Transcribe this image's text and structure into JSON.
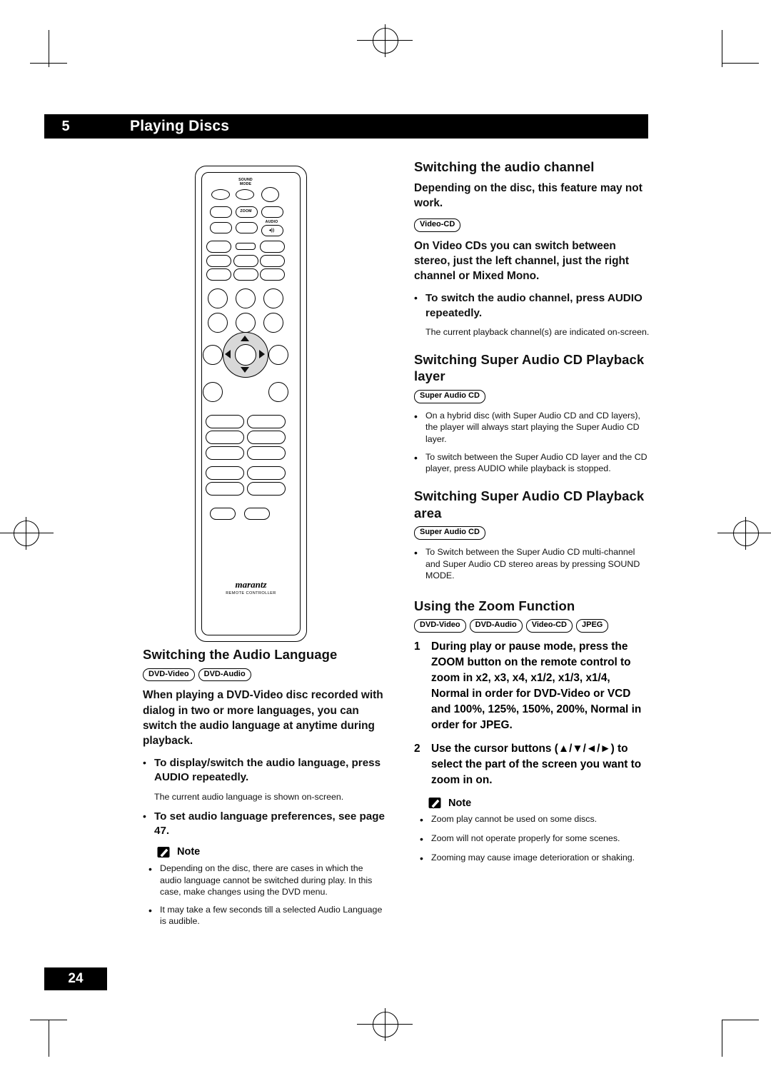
{
  "header": {
    "chapter_number": "5",
    "chapter_title": "Playing Discs"
  },
  "footer": {
    "page_number": "24"
  },
  "remote": {
    "labels": {
      "sound_mode_line1": "SOUND",
      "sound_mode_line2": "MODE",
      "zoom": "ZOOM",
      "audio": "AUDIO",
      "audio_symbol": "◂))",
      "brand": "marantz",
      "brand_sub": "REMOTE CONTROLLER"
    }
  },
  "left_column": {
    "section_title": "Switching the Audio Language",
    "badges": [
      "DVD-Video",
      "DVD-Audio"
    ],
    "paragraph": "When playing a DVD-Video disc recorded with dialog in two or more languages, you can switch the audio language at anytime during playback.",
    "bullets": [
      {
        "bold": "To display/switch the audio language, press AUDIO repeatedly.",
        "sub": "The current audio language is shown on-screen."
      },
      {
        "bold": "To set audio language preferences, see page 47.",
        "sub": ""
      }
    ],
    "note_label": "Note",
    "notes": [
      "Depending on the disc, there are cases in which the audio language cannot be switched during play. In this case, make changes using the DVD menu.",
      "It may take a few seconds till a selected Audio Language is audible."
    ]
  },
  "right_column": {
    "sections": [
      {
        "title": "Switching the audio channel",
        "intro": "Depending on the disc, this feature may not work.",
        "badges": [
          "Video-CD"
        ],
        "paragraph": "On Video CDs you can switch between stereo, just the left channel, just the right channel or Mixed Mono.",
        "bullet_bold": "To switch the audio channel, press AUDIO repeatedly.",
        "bullet_sub": "The current playback channel(s) are indicated on-screen."
      },
      {
        "title": "Switching Super Audio CD Playback layer",
        "badges": [
          "Super Audio CD"
        ],
        "bullets": [
          "On a hybrid disc (with Super Audio CD and CD layers), the player will always start playing the Super Audio CD layer.",
          "To switch between the Super Audio CD layer and the CD player, press AUDIO while playback is stopped."
        ]
      },
      {
        "title": "Switching Super Audio CD Playback area",
        "badges": [
          "Super Audio CD"
        ],
        "bullets": [
          "To Switch between the Super Audio CD multi-channel and Super Audio CD stereo areas by pressing SOUND MODE."
        ]
      },
      {
        "title": "Using the Zoom Function",
        "badges": [
          "DVD-Video",
          "DVD-Audio",
          "Video-CD",
          "JPEG"
        ],
        "steps": [
          {
            "num": "1",
            "text": "During play or pause mode, press the ZOOM button on the remote control to zoom in x2, x3, x4, x1/2, x1/3, x1/4, Normal in order for DVD-Video or VCD and 100%, 125%, 150%, 200%, Normal in order for JPEG."
          },
          {
            "num": "2",
            "text": "Use the cursor buttons (▲/▼/◄/►) to select the part of the screen you want to zoom in on."
          }
        ],
        "note_label": "Note",
        "notes": [
          "Zoom play cannot be used on some discs.",
          "Zoom will not operate properly for some scenes.",
          "Zooming may cause image deterioration or shaking."
        ]
      }
    ]
  }
}
